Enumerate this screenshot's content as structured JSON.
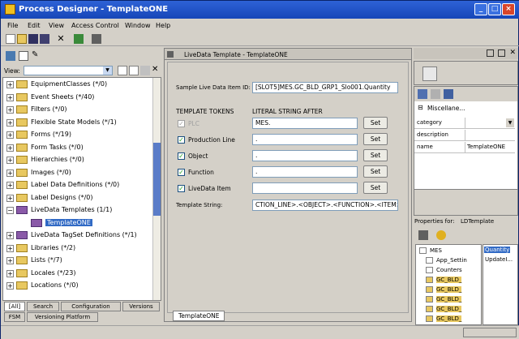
{
  "title": "Process Designer - TemplateONE",
  "menu": [
    "File",
    "Edit",
    "View",
    "Access Control",
    "Window",
    "Help"
  ],
  "left": {
    "view_label": "View:",
    "tree": [
      {
        "label": "EquipmentClasses (*/0)",
        "sign": "+",
        "color": "yellow"
      },
      {
        "label": "Event Sheets (*/40)",
        "sign": "+",
        "color": "yellow"
      },
      {
        "label": "Filters (*/0)",
        "sign": "+",
        "color": "yellow"
      },
      {
        "label": "Flexible State Models (*/1)",
        "sign": "+",
        "color": "yellow"
      },
      {
        "label": "Forms (*/19)",
        "sign": "+",
        "color": "yellow"
      },
      {
        "label": "Form Tasks (*/0)",
        "sign": "+",
        "color": "yellow"
      },
      {
        "label": "Hierarchies (*/0)",
        "sign": "+",
        "color": "yellow"
      },
      {
        "label": "Images (*/0)",
        "sign": "+",
        "color": "yellow"
      },
      {
        "label": "Label Data Definitions (*/0)",
        "sign": "+",
        "color": "yellow"
      },
      {
        "label": "Label Designs (*/0)",
        "sign": "+",
        "color": "yellow"
      },
      {
        "label": "LiveData Templates (1/1)",
        "sign": "−",
        "color": "purple"
      },
      {
        "label": "TemplateONE",
        "sign": "",
        "color": "purple",
        "child": true,
        "selected": true
      },
      {
        "label": "LiveData TagSet Definitions (*/1)",
        "sign": "+",
        "color": "purple"
      },
      {
        "label": "Libraries (*/2)",
        "sign": "+",
        "color": "yellow"
      },
      {
        "label": "Lists (*/7)",
        "sign": "+",
        "color": "yellow"
      },
      {
        "label": "Locales (*/23)",
        "sign": "+",
        "color": "yellow"
      },
      {
        "label": "Locations (*/0)",
        "sign": "+",
        "color": "yellow"
      }
    ],
    "tabs_row1": [
      "[All]",
      "Search",
      "Configuration",
      "Versions"
    ],
    "tabs_row2": [
      "FSM",
      "Versioning Platform"
    ]
  },
  "editor": {
    "title": "LiveData Template - TemplateONE",
    "sample_label": "Sample Live Data Item ID:",
    "sample_value": "[SLOT5]MES.GC_BLD_GRP1_Slo001.Quantity",
    "col1": "TEMPLATE TOKENS",
    "col2": "LITERAL STRING AFTER",
    "tokens": [
      {
        "label": "PLC",
        "value": "MES.",
        "set": "Set",
        "disabled": true
      },
      {
        "label": "Production Line",
        "value": ".",
        "set": "Set",
        "disabled": false
      },
      {
        "label": "Object",
        "value": ".",
        "set": "Set",
        "disabled": false
      },
      {
        "label": "Function",
        "value": ".",
        "set": "Set",
        "disabled": false
      },
      {
        "label": "LiveData Item",
        "value": "",
        "set": "Set",
        "disabled": false
      }
    ],
    "template_label": "Template String:",
    "template_value": "CTION_LINE>.<OBJECT>.<FUNCTION>.<ITEM>",
    "tab": "TemplateONE"
  },
  "props": {
    "section": "Miscellane...",
    "rows": [
      {
        "name": "category",
        "value": ""
      },
      {
        "name": "description",
        "value": ""
      },
      {
        "name": "name",
        "value": "TemplateONE"
      }
    ],
    "for_label": "Properties for:",
    "for_value": "LDTemplate"
  },
  "bottom": {
    "tree": [
      "MES",
      "App_Settin",
      "Counters",
      "GC_BLD_",
      "GC_BLD_",
      "GC_BLD_",
      "GC_BLD_",
      "GC_BLD_"
    ],
    "list": [
      "Quantity",
      "UpdateI..."
    ]
  }
}
